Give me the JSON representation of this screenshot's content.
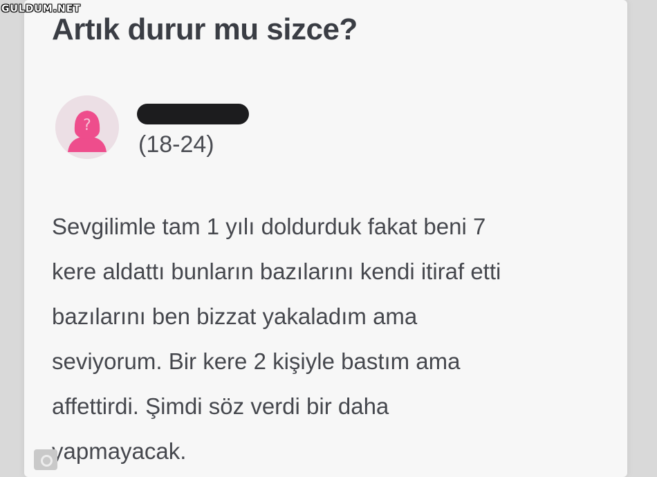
{
  "watermark": "GULDUM.NET",
  "post": {
    "title": "Artık durur mu sizce?",
    "author": {
      "avatar_icon": "female-avatar-icon",
      "age_range": "(18-24)"
    },
    "body_lines": [
      "Sevgilimle tam 1 yılı doldurduk fakat beni 7",
      "kere aldattı bunların bazılarını kendi itiraf etti",
      "bazılarını ben bizzat yakaladım ama",
      "seviyorum. Bir kere 2 kişiyle bastım ama",
      "affettirdi. Şimdi söz verdi bir daha",
      "yapmayacak."
    ]
  },
  "colors": {
    "avatar_accent": "#ee4d8c",
    "avatar_background": "#ecdfe5",
    "title_text": "#3a3d44",
    "body_text": "#45474d"
  }
}
